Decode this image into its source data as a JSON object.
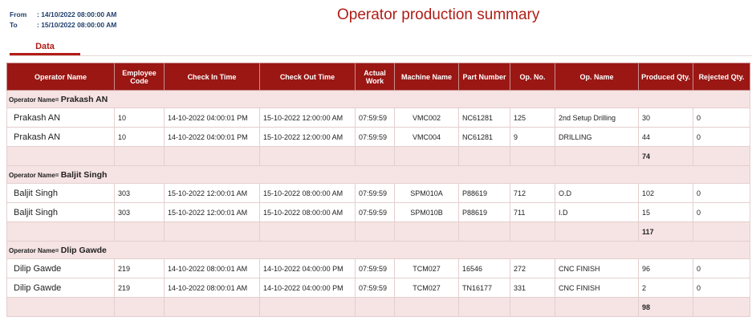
{
  "header": {
    "from_label": "From",
    "from_value": ": 14/10/2022 08:00:00 AM",
    "to_label": "To",
    "to_value": ": 15/10/2022 08:00:00 AM",
    "title": "Operator production summary"
  },
  "tabs": [
    {
      "label": "Data"
    }
  ],
  "table": {
    "columns": [
      "Operator Name",
      "Employee Code",
      "Check In Time",
      "Check Out Time",
      "Actual Work",
      "Machine Name",
      "Part Number",
      "Op. No.",
      "Op. Name",
      "Produced Qty.",
      "Rejected Qty."
    ],
    "group_prefix": "Operator Name=",
    "groups": [
      {
        "name": "Prakash AN",
        "rows": [
          {
            "operator": "Prakash AN",
            "code": "10",
            "check_in": "14-10-2022 04:00:01 PM",
            "check_out": "15-10-2022 12:00:00 AM",
            "actual": "07:59:59",
            "machine": "VMC002",
            "part": "NC61281",
            "op_no": "125",
            "op_name": "2nd Setup Drilling",
            "produced": "30",
            "rejected": "0"
          },
          {
            "operator": "Prakash AN",
            "code": "10",
            "check_in": "14-10-2022 04:00:01 PM",
            "check_out": "15-10-2022 12:00:00 AM",
            "actual": "07:59:59",
            "machine": "VMC004",
            "part": "NC61281",
            "op_no": "9",
            "op_name": "DRILLING",
            "produced": "44",
            "rejected": "0"
          }
        ],
        "total": "74"
      },
      {
        "name": "Baljit Singh",
        "rows": [
          {
            "operator": "Baljit Singh",
            "code": "303",
            "check_in": "15-10-2022 12:00:01 AM",
            "check_out": "15-10-2022 08:00:00 AM",
            "actual": "07:59:59",
            "machine": "SPM010A",
            "part": "P88619",
            "op_no": "712",
            "op_name": "O.D",
            "produced": "102",
            "rejected": "0"
          },
          {
            "operator": "Baljit Singh",
            "code": "303",
            "check_in": "15-10-2022 12:00:01 AM",
            "check_out": "15-10-2022 08:00:00 AM",
            "actual": "07:59:59",
            "machine": "SPM010B",
            "part": "P88619",
            "op_no": "711",
            "op_name": "I.D",
            "produced": "15",
            "rejected": "0"
          }
        ],
        "total": "117"
      },
      {
        "name": "Dlip Gawde",
        "rows": [
          {
            "operator": "Dilip Gawde",
            "code": "219",
            "check_in": "14-10-2022 08:00:01 AM",
            "check_out": "14-10-2022 04:00:00 PM",
            "actual": "07:59:59",
            "machine": "TCM027",
            "part": "16546",
            "op_no": "272",
            "op_name": "CNC FINISH",
            "produced": "96",
            "rejected": "0"
          },
          {
            "operator": "Dilip Gawde",
            "code": "219",
            "check_in": "14-10-2022 08:00:01 AM",
            "check_out": "14-10-2022 04:00:00 PM",
            "actual": "07:59:59",
            "machine": "TCM027",
            "part": "TN16177",
            "op_no": "331",
            "op_name": "CNC FINISH",
            "produced": "2",
            "rejected": "0"
          }
        ],
        "total": "98"
      }
    ]
  }
}
